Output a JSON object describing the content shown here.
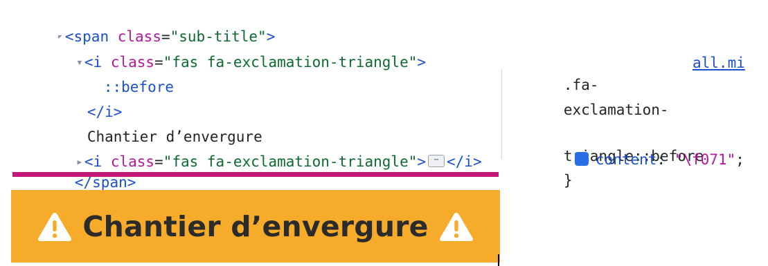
{
  "dom_tree": {
    "line1": {
      "open_lt": "<",
      "tag": "span",
      "space": " ",
      "attr": "class",
      "eq": "=",
      "val": "\"sub-title\"",
      "gt": ">"
    },
    "line2": {
      "open_lt": "<",
      "tag": "i",
      "space": " ",
      "attr": "class",
      "eq": "=",
      "val": "\"fas fa-exclamation-triangle\"",
      "gt": ">"
    },
    "line3": {
      "pseudo": "::before"
    },
    "line4": {
      "close": "</i>"
    },
    "line5": {
      "text": "Chantier d’envergure"
    },
    "line6": {
      "open_lt": "<",
      "tag": "i",
      "space": " ",
      "attr": "class",
      "eq": "=",
      "val": "\"fas fa-exclamation-triangle\"",
      "gt": ">",
      "close": "</i>"
    },
    "line7": {
      "close_lt": "</",
      "tag": "span",
      "gt": ">"
    }
  },
  "css_rule": {
    "selector_line1": ".fa-",
    "selector_line2": "exclamation-",
    "selector_line3": "triangle::before",
    "open_brace": "{",
    "close_brace": "}",
    "source": "all.mi",
    "property": "content",
    "colon": ":",
    "value": "\"\\f071\"",
    "semicolon": ";",
    "enabled": true
  },
  "preview": {
    "title": "Chantier d’envergure",
    "icon": "exclamation-triangle-icon",
    "background": "#f7ab2a"
  },
  "colors": {
    "tag": "#1a4fd1",
    "attr": "#b5179e",
    "string": "#0d6b2e",
    "highlight_bar": "#c4187a"
  }
}
